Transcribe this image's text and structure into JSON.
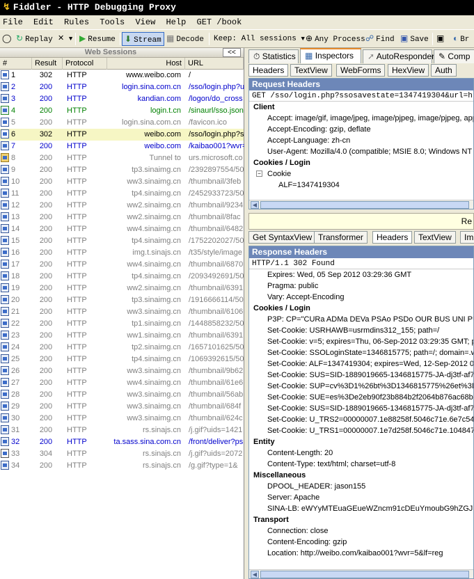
{
  "title": "Fiddler - HTTP Debugging Proxy",
  "menu": [
    "File",
    "Edit",
    "Rules",
    "Tools",
    "View",
    "Help",
    "GET /book"
  ],
  "toolbar": {
    "replay": "Replay",
    "remove": "✕",
    "resume": "Resume",
    "stream": "Stream",
    "decode": "Decode",
    "keep": "Keep: All sessions",
    "process": "Any Process",
    "find": "Find",
    "save": "Save",
    "browse": "Br"
  },
  "sessions_panel": {
    "title": "Web Sessions",
    "collapse": "<<",
    "columns": [
      "#",
      "Result",
      "Protocol",
      "Host",
      "URL"
    ]
  },
  "sessions": [
    {
      "num": "1",
      "result": "302",
      "protocol": "HTTP",
      "host": "www.weibo.com",
      "url": "/",
      "color": "black",
      "icon": "page"
    },
    {
      "num": "2",
      "result": "200",
      "protocol": "HTTP",
      "host": "login.sina.com.cn",
      "url": "/sso/login.php?u",
      "color": "blue",
      "icon": "script"
    },
    {
      "num": "3",
      "result": "200",
      "protocol": "HTTP",
      "host": "kandian.com",
      "url": "/logon/do_cross",
      "color": "blue",
      "icon": "script"
    },
    {
      "num": "4",
      "result": "200",
      "protocol": "HTTP",
      "host": "login.t.cn",
      "url": "/sinaurl/sso.json",
      "color": "green",
      "icon": "json"
    },
    {
      "num": "5",
      "result": "200",
      "protocol": "HTTP",
      "host": "login.sina.com.cn",
      "url": "/favicon.ico",
      "color": "gray",
      "icon": "page"
    },
    {
      "num": "6",
      "result": "302",
      "protocol": "HTTP",
      "host": "weibo.com",
      "url": "/sso/login.php?s",
      "color": "black",
      "icon": "page",
      "selected": true
    },
    {
      "num": "7",
      "result": "200",
      "protocol": "HTTP",
      "host": "weibo.com",
      "url": "/kaibao001?wvr=",
      "color": "blue",
      "icon": "script"
    },
    {
      "num": "8",
      "result": "200",
      "protocol": "HTTP",
      "host": "Tunnel to",
      "url": "urs.microsoft.co",
      "color": "gray",
      "icon": "lock"
    },
    {
      "num": "9",
      "result": "200",
      "protocol": "HTTP",
      "host": "tp3.sinaimg.cn",
      "url": "/2392897554/50",
      "color": "gray",
      "icon": "img"
    },
    {
      "num": "10",
      "result": "200",
      "protocol": "HTTP",
      "host": "ww3.sinaimg.cn",
      "url": "/thumbnail/3feb",
      "color": "gray",
      "icon": "img"
    },
    {
      "num": "11",
      "result": "200",
      "protocol": "HTTP",
      "host": "tp4.sinaimg.cn",
      "url": "/2452933723/50",
      "color": "gray",
      "icon": "img"
    },
    {
      "num": "12",
      "result": "200",
      "protocol": "HTTP",
      "host": "ww2.sinaimg.cn",
      "url": "/thumbnail/9234",
      "color": "gray",
      "icon": "img"
    },
    {
      "num": "13",
      "result": "200",
      "protocol": "HTTP",
      "host": "ww2.sinaimg.cn",
      "url": "/thumbnail/8fac",
      "color": "gray",
      "icon": "img"
    },
    {
      "num": "14",
      "result": "200",
      "protocol": "HTTP",
      "host": "ww4.sinaimg.cn",
      "url": "/thumbnail/6482",
      "color": "gray",
      "icon": "img"
    },
    {
      "num": "15",
      "result": "200",
      "protocol": "HTTP",
      "host": "tp4.sinaimg.cn",
      "url": "/1752202027/50",
      "color": "gray",
      "icon": "img"
    },
    {
      "num": "16",
      "result": "200",
      "protocol": "HTTP",
      "host": "img.t.sinajs.cn",
      "url": "/t35/style/image",
      "color": "gray",
      "icon": "img"
    },
    {
      "num": "17",
      "result": "200",
      "protocol": "HTTP",
      "host": "ww4.sinaimg.cn",
      "url": "/thumbnail/6870",
      "color": "gray",
      "icon": "img"
    },
    {
      "num": "18",
      "result": "200",
      "protocol": "HTTP",
      "host": "tp4.sinaimg.cn",
      "url": "/2093492691/50",
      "color": "gray",
      "icon": "img"
    },
    {
      "num": "19",
      "result": "200",
      "protocol": "HTTP",
      "host": "ww2.sinaimg.cn",
      "url": "/thumbnail/6391",
      "color": "gray",
      "icon": "img"
    },
    {
      "num": "20",
      "result": "200",
      "protocol": "HTTP",
      "host": "tp3.sinaimg.cn",
      "url": "/1916666114/50",
      "color": "gray",
      "icon": "img"
    },
    {
      "num": "21",
      "result": "200",
      "protocol": "HTTP",
      "host": "ww3.sinaimg.cn",
      "url": "/thumbnail/6106",
      "color": "gray",
      "icon": "img"
    },
    {
      "num": "22",
      "result": "200",
      "protocol": "HTTP",
      "host": "tp1.sinaimg.cn",
      "url": "/1448858232/50",
      "color": "gray",
      "icon": "img"
    },
    {
      "num": "23",
      "result": "200",
      "protocol": "HTTP",
      "host": "ww1.sinaimg.cn",
      "url": "/thumbnail/6391",
      "color": "gray",
      "icon": "img"
    },
    {
      "num": "24",
      "result": "200",
      "protocol": "HTTP",
      "host": "tp2.sinaimg.cn",
      "url": "/1657101625/50",
      "color": "gray",
      "icon": "img"
    },
    {
      "num": "25",
      "result": "200",
      "protocol": "HTTP",
      "host": "tp4.sinaimg.cn",
      "url": "/1069392615/50",
      "color": "gray",
      "icon": "img"
    },
    {
      "num": "26",
      "result": "200",
      "protocol": "HTTP",
      "host": "ww3.sinaimg.cn",
      "url": "/thumbnail/9b62",
      "color": "gray",
      "icon": "img"
    },
    {
      "num": "27",
      "result": "200",
      "protocol": "HTTP",
      "host": "ww4.sinaimg.cn",
      "url": "/thumbnail/61e6",
      "color": "gray",
      "icon": "img"
    },
    {
      "num": "28",
      "result": "200",
      "protocol": "HTTP",
      "host": "ww3.sinaimg.cn",
      "url": "/thumbnail/56ab",
      "color": "gray",
      "icon": "img"
    },
    {
      "num": "29",
      "result": "200",
      "protocol": "HTTP",
      "host": "ww3.sinaimg.cn",
      "url": "/thumbnail/684f",
      "color": "gray",
      "icon": "img"
    },
    {
      "num": "30",
      "result": "200",
      "protocol": "HTTP",
      "host": "ww3.sinaimg.cn",
      "url": "/thumbnail/624c",
      "color": "gray",
      "icon": "img"
    },
    {
      "num": "31",
      "result": "200",
      "protocol": "HTTP",
      "host": "rs.sinajs.cn",
      "url": "/j.gif?uids=1421",
      "color": "gray",
      "icon": "img"
    },
    {
      "num": "32",
      "result": "200",
      "protocol": "HTTP",
      "host": "ta.sass.sina.com.cn",
      "url": "/front/deliver?ps",
      "color": "blue",
      "icon": "script"
    },
    {
      "num": "33",
      "result": "304",
      "protocol": "HTTP",
      "host": "rs.sinajs.cn",
      "url": "/j.gif?uids=2072",
      "color": "gray",
      "icon": "diamond"
    },
    {
      "num": "34",
      "result": "200",
      "protocol": "HTTP",
      "host": "rs.sinajs.cn",
      "url": "/g.gif?type=1&",
      "color": "gray",
      "icon": "img"
    }
  ],
  "main_tabs": [
    {
      "label": "Statistics",
      "icon": "stopwatch-icon"
    },
    {
      "label": "Inspectors",
      "icon": "inspect-icon",
      "active": true
    },
    {
      "label": "AutoResponder",
      "icon": "lightning-icon"
    },
    {
      "label": "Comp",
      "icon": "compose-icon"
    }
  ],
  "request_tabs": [
    "Headers",
    "TextView",
    "WebForms",
    "HexView",
    "Auth"
  ],
  "request": {
    "title": "Request Headers",
    "line": "GET /sso/login.php?ssosavestate=1347419304&url=http%3",
    "groups": [
      {
        "name": "Client",
        "items": [
          "Accept: image/gif, image/jpeg, image/pjpeg, image/pjpeg, app",
          "Accept-Encoding: gzip, deflate",
          "Accept-Language: zh-cn",
          "User-Agent: Mozilla/4.0 (compatible; MSIE 8.0; Windows NT 5"
        ]
      },
      {
        "name": "Cookies / Login",
        "items": []
      }
    ],
    "cookie_node": "Cookie",
    "cookie_item": "ALF=1347419304"
  },
  "warn_text": "Re",
  "response_tabs": [
    "Get SyntaxView",
    "Transformer",
    "Headers",
    "TextView",
    "Im"
  ],
  "response": {
    "title": "Response Headers",
    "line": "HTTP/1.1 302 Found",
    "top_items": [
      "Expires: Wed, 05 Sep 2012 03:29:36 GMT",
      "Pragma: public",
      "Vary: Accept-Encoding"
    ],
    "groups": [
      {
        "name": "Cookies / Login",
        "items": [
          "P3P: CP=\"CURa ADMa DEVa PSAo PSDo OUR BUS UNI PUR IN",
          "Set-Cookie: USRHAWB=usrmdins312_155; path=/",
          "Set-Cookie: v=5; expires=Thu, 06-Sep-2012 03:29:35 GMT; p",
          "Set-Cookie: SSOLoginState=1346815775; path=/; domain=.w",
          "Set-Cookie: ALF=1347419304; expires=Wed, 12-Sep-2012 03",
          "Set-Cookie: SUS=SID-1889019665-1346815775-JA-dj3tf-af7c",
          "Set-Cookie: SUP=cv%3D1%26bt%3D1346815775%26et%3D",
          "Set-Cookie: SUE=es%3De2eb90f23b884b2f2064b876ac68b6",
          "Set-Cookie: SUS=SID-1889019665-1346815775-JA-dj3tf-af7c",
          "Set-Cookie: U_TRS2=00000007.1e88258f.5046c71e.6e7c545",
          "Set-Cookie: U_TRS1=00000007.1e7d258f.5046c71e.104847"
        ]
      },
      {
        "name": "Entity",
        "items": [
          "Content-Length: 20",
          "Content-Type: text/html; charset=utf-8"
        ]
      },
      {
        "name": "Miscellaneous",
        "items": [
          "DPOOL_HEADER: jason155",
          "Server: Apache",
          "SINA-LB: eWYyMTEuaGEueWZncm91cDEuYmoubG9hZGJhbGF"
        ]
      },
      {
        "name": "Transport",
        "items": [
          "Connection: close",
          "Content-Encoding: gzip",
          "Location: http://weibo.com/kaibao001?wvr=5&lf=reg"
        ]
      }
    ]
  }
}
